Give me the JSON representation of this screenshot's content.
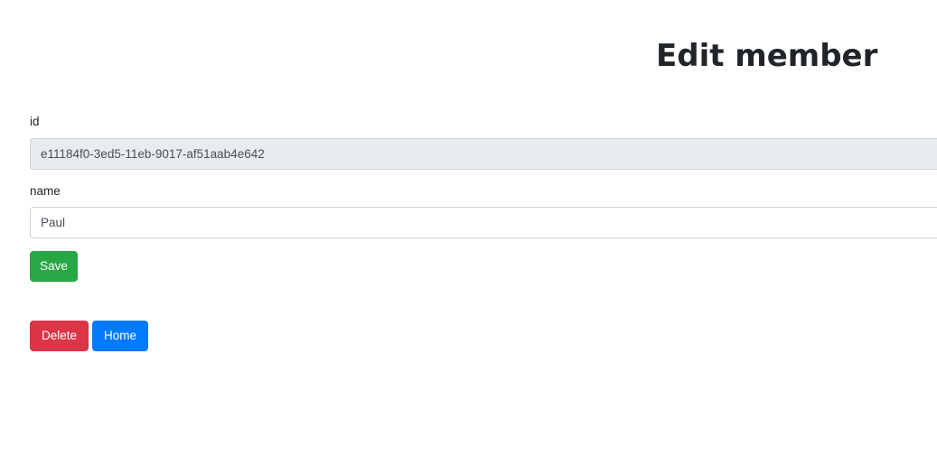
{
  "page": {
    "title": "Edit member"
  },
  "form": {
    "id_label": "id",
    "id_value": "e11184f0-3ed5-11eb-9017-af51aab4e642",
    "name_label": "name",
    "name_value": "Paul",
    "save_label": "Save"
  },
  "actions": {
    "delete_label": "Delete",
    "home_label": "Home"
  },
  "colors": {
    "save": "#28a745",
    "delete": "#dc3545",
    "home": "#007bff",
    "readonly_bg": "#e9ecef"
  }
}
